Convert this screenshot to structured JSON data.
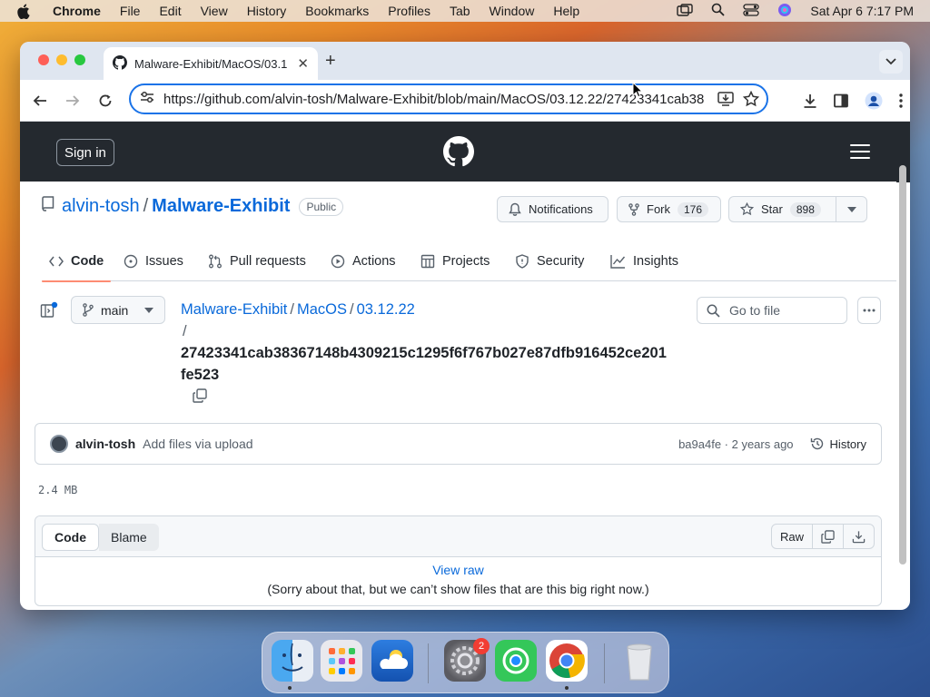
{
  "menubar": {
    "app": "Chrome",
    "items": [
      "File",
      "Edit",
      "View",
      "History",
      "Bookmarks",
      "Profiles",
      "Tab",
      "Window",
      "Help"
    ],
    "clock": "Sat Apr 6  7:17 PM"
  },
  "browser": {
    "tab_title": "Malware-Exhibit/MacOS/03.1",
    "url": "https://github.com/alvin-tosh/Malware-Exhibit/blob/main/MacOS/03.12.22/27423341cab38"
  },
  "github": {
    "sign_in": "Sign in",
    "repo": {
      "owner": "alvin-tosh",
      "separator": "/",
      "name": "Malware-Exhibit",
      "visibility": "Public"
    },
    "actions": {
      "notifications": "Notifications",
      "fork_label": "Fork",
      "fork_count": "176",
      "star_label": "Star",
      "star_count": "898"
    },
    "tabs": [
      {
        "label": "Code",
        "icon": "code-icon"
      },
      {
        "label": "Issues",
        "icon": "issue-icon"
      },
      {
        "label": "Pull requests",
        "icon": "pull-request-icon"
      },
      {
        "label": "Actions",
        "icon": "play-icon"
      },
      {
        "label": "Projects",
        "icon": "table-icon"
      },
      {
        "label": "Security",
        "icon": "shield-icon"
      },
      {
        "label": "Insights",
        "icon": "graph-icon"
      }
    ],
    "branch": "main",
    "breadcrumb": {
      "root": "Malware-Exhibit",
      "folder1": "MacOS",
      "folder2": "03.12.22",
      "separator": "/",
      "file": "27423341cab38367148b4309215c1295f6f767b027e87dfb916452ce201fe523"
    },
    "go_to_file": "Go to file",
    "commit": {
      "author": "alvin-tosh",
      "message": "Add files via upload",
      "meta": "ba9a4fe · 2 years ago",
      "history": "History"
    },
    "file_size": "2.4 MB",
    "file_view": {
      "code": "Code",
      "blame": "Blame",
      "raw": "Raw",
      "view_raw": "View raw",
      "notice": "(Sorry about that, but we can’t show files that are this big right now.)"
    }
  },
  "dock": {
    "items": [
      "Finder",
      "Launchpad",
      "Weather",
      "System Settings",
      "Find My",
      "Chrome",
      "Trash"
    ],
    "settings_badge": "2"
  },
  "colors": {
    "link": "#0969da",
    "header": "#24292f",
    "active_tab_underline": "#fd8c73",
    "focus_ring": "#1a73e8"
  }
}
